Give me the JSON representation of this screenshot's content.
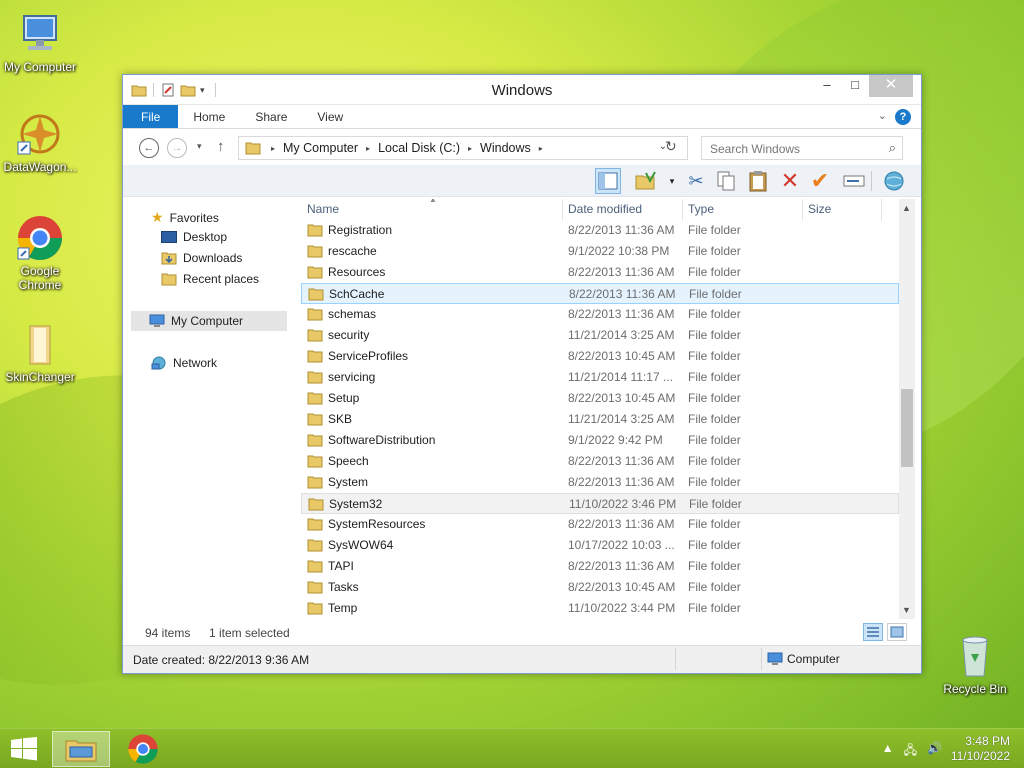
{
  "desktop": {
    "icons": [
      {
        "label": "My Computer"
      },
      {
        "label": "DataWagon..."
      },
      {
        "label": "Google Chrome"
      },
      {
        "label": "SkinChanger"
      },
      {
        "label": "Recycle Bin"
      }
    ]
  },
  "window": {
    "title": "Windows",
    "controls": {
      "minimize": "–",
      "maximize": "□",
      "close": "✕"
    },
    "ribbon": {
      "tabs": [
        "File",
        "Home",
        "Share",
        "View"
      ],
      "help": "?"
    },
    "address": {
      "segments": [
        "My Computer",
        "Local Disk (C:)",
        "Windows"
      ],
      "search_placeholder": "Search Windows"
    },
    "sidebar": {
      "favorites": "Favorites",
      "desktop": "Desktop",
      "downloads": "Downloads",
      "recent": "Recent places",
      "computer": "My Computer",
      "network": "Network"
    },
    "columns": {
      "name": "Name",
      "date": "Date modified",
      "type": "Type",
      "size": "Size"
    },
    "files": [
      {
        "name": "Registration",
        "date": "8/22/2013 11:36 AM",
        "type": "File folder"
      },
      {
        "name": "rescache",
        "date": "9/1/2022 10:38 PM",
        "type": "File folder"
      },
      {
        "name": "Resources",
        "date": "8/22/2013 11:36 AM",
        "type": "File folder"
      },
      {
        "name": "SchCache",
        "date": "8/22/2013 11:36 AM",
        "type": "File folder"
      },
      {
        "name": "schemas",
        "date": "8/22/2013 11:36 AM",
        "type": "File folder"
      },
      {
        "name": "security",
        "date": "11/21/2014 3:25 AM",
        "type": "File folder"
      },
      {
        "name": "ServiceProfiles",
        "date": "8/22/2013 10:45 AM",
        "type": "File folder"
      },
      {
        "name": "servicing",
        "date": "11/21/2014 11:17 ...",
        "type": "File folder"
      },
      {
        "name": "Setup",
        "date": "8/22/2013 10:45 AM",
        "type": "File folder"
      },
      {
        "name": "SKB",
        "date": "11/21/2014 3:25 AM",
        "type": "File folder"
      },
      {
        "name": "SoftwareDistribution",
        "date": "9/1/2022 9:42 PM",
        "type": "File folder"
      },
      {
        "name": "Speech",
        "date": "8/22/2013 11:36 AM",
        "type": "File folder"
      },
      {
        "name": "System",
        "date": "8/22/2013 11:36 AM",
        "type": "File folder"
      },
      {
        "name": "System32",
        "date": "11/10/2022 3:46 PM",
        "type": "File folder"
      },
      {
        "name": "SystemResources",
        "date": "8/22/2013 11:36 AM",
        "type": "File folder"
      },
      {
        "name": "SysWOW64",
        "date": "10/17/2022 10:03 ...",
        "type": "File folder"
      },
      {
        "name": "TAPI",
        "date": "8/22/2013 11:36 AM",
        "type": "File folder"
      },
      {
        "name": "Tasks",
        "date": "8/22/2013 10:45 AM",
        "type": "File folder"
      },
      {
        "name": "Temp",
        "date": "11/10/2022 3:44 PM",
        "type": "File folder"
      }
    ],
    "status": {
      "count": "94 items",
      "selected": "1 item selected",
      "info": "Date created: 8/22/2013 9:36 AM",
      "location": "Computer"
    }
  },
  "taskbar": {
    "time": "3:48 PM",
    "date": "11/10/2022"
  },
  "colors": {
    "accent": "#1979ca",
    "selection": "#e5f3ff",
    "taskbar": "#7aa720"
  }
}
